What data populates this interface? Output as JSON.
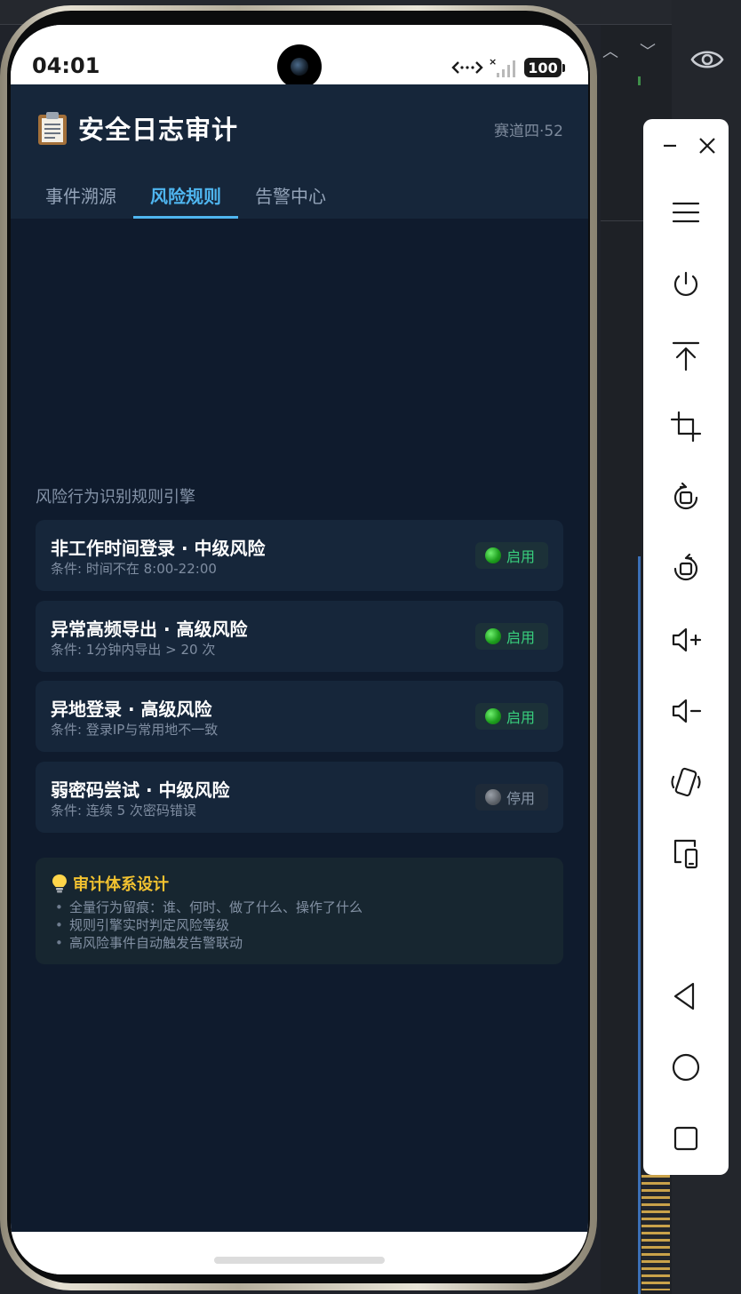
{
  "status_bar": {
    "time": "04:01",
    "battery": "100",
    "icons": [
      "data-transfer-icon",
      "no-signal-icon",
      "battery-icon"
    ]
  },
  "app": {
    "title": "安全日志审计",
    "title_icon": "clipboard-icon",
    "lane_tag": "赛道四·52",
    "tabs": [
      {
        "label": "事件溯源",
        "active": false
      },
      {
        "label": "风险规则",
        "active": true
      },
      {
        "label": "告警中心",
        "active": false
      }
    ],
    "section_label": "风险行为识别规则引擎",
    "rules": [
      {
        "title": "非工作时间登录 · 中级风险",
        "condition": "条件: 时间不在 8:00-22:00",
        "status": "启用",
        "enabled": true
      },
      {
        "title": "异常高频导出 · 高级风险",
        "condition": "条件: 1分钟内导出 > 20 次",
        "status": "启用",
        "enabled": true
      },
      {
        "title": "异地登录 · 高级风险",
        "condition": "条件: 登录IP与常用地不一致",
        "status": "启用",
        "enabled": true
      },
      {
        "title": "弱密码尝试 · 中级风险",
        "condition": "条件: 连续 5 次密码错误",
        "status": "停用",
        "enabled": false
      }
    ],
    "info": {
      "icon": "lightbulb-icon",
      "title": "审计体系设计",
      "items": [
        "全量行为留痕：谁、何时、做了什么、操作了什么",
        "规则引擎实时判定风险等级",
        "高风险事件自动触发告警联动"
      ]
    }
  },
  "colors": {
    "app_bg": "#0f1b2d",
    "header_bg": "#16263a",
    "accent": "#4fb6f0",
    "enabled": "#38d07d",
    "info_title": "#f2c230"
  },
  "emulator_toolbar": {
    "buttons": [
      "minimize-icon",
      "close-icon",
      "menu-icon",
      "power-icon",
      "pin-top-icon",
      "crop-icon",
      "rotate-left-icon",
      "rotate-right-icon",
      "volume-up-icon",
      "volume-down-icon",
      "shake-icon",
      "multi-display-icon",
      "back-icon",
      "home-icon",
      "overview-icon"
    ]
  }
}
